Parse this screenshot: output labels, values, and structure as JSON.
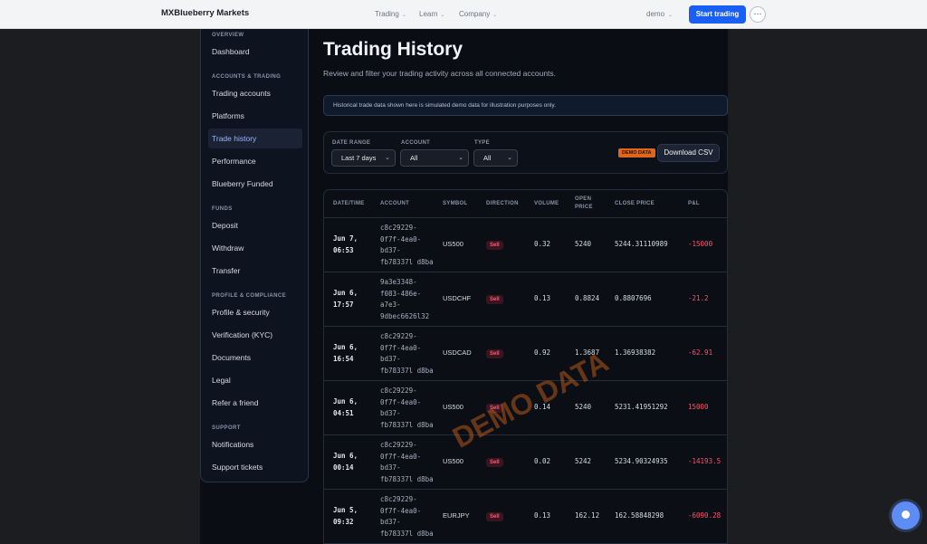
{
  "topbar": {
    "brand": "MXBlueberry Markets",
    "nav": [
      {
        "label": "Trading"
      },
      {
        "label": "Learn"
      },
      {
        "label": "Company"
      }
    ],
    "demo_select": "demo",
    "start_label": "Start trading",
    "more_label": "···"
  },
  "sidebar": {
    "sections": {
      "overview": "OVERVIEW",
      "accounts": "ACCOUNTS & TRADING",
      "funds": "FUNDS",
      "profile": "PROFILE & COMPLIANCE",
      "support": "SUPPORT"
    },
    "items": {
      "dashboard": "Dashboard",
      "trading_accounts": "Trading accounts",
      "platforms": "Platforms",
      "trade_history": "Trade history",
      "performance": "Performance",
      "funded": "Blueberry Funded",
      "deposit": "Deposit",
      "withdraw": "Withdraw",
      "transfer": "Transfer",
      "profile_security": "Profile & security",
      "verification": "Verification (KYC)",
      "documents": "Documents",
      "legal": "Legal",
      "refer": "Refer a friend",
      "notifications": "Notifications",
      "tickets": "Support tickets"
    }
  },
  "page": {
    "title": "Trading History",
    "subtitle": "Review and filter your trading activity across all connected accounts.",
    "notice": "Historical trade data shown here is simulated demo data for illustration purposes only."
  },
  "filters": {
    "date_label": "DATE RANGE",
    "date_value": "Last 7 days",
    "account_label": "ACCOUNT",
    "account_value": "All",
    "type_label": "TYPE",
    "type_value": "All",
    "demo_badge": "DEMO DATA",
    "download_label": "Download CSV"
  },
  "table": {
    "headers": {
      "datetime": "DATE/TIME",
      "account": "ACCOUNT",
      "symbol": "SYMBOL",
      "direction": "DIRECTION",
      "volume": "VOLUME",
      "open_price_1": "OPEN",
      "open_price_2": "PRICE",
      "close_price": "CLOSE PRICE",
      "pnl": "P&L"
    },
    "rows": [
      {
        "date": "Jun 7,",
        "time": "06:53",
        "acct": [
          "c8c29229-",
          "0f7f-4ea0-",
          "bd37-",
          "fb78337l d8ba"
        ],
        "symbol": "US500",
        "direction": "Sell",
        "volume": "0.32",
        "open": "5240",
        "close": "5244.31110989",
        "pnl": "-15000"
      },
      {
        "date": "Jun 6,",
        "time": "17:57",
        "acct": [
          "9a3e3348-",
          "f083-486e-",
          "a7e3-",
          "9dbec6626l32"
        ],
        "symbol": "USDCHF",
        "direction": "Sell",
        "volume": "0.13",
        "open": "0.8824",
        "close": "0.8807696",
        "pnl": "-21.2"
      },
      {
        "date": "Jun 6,",
        "time": "16:54",
        "acct": [
          "c8c29229-",
          "0f7f-4ea0-",
          "bd37-",
          "fb78337l d8ba"
        ],
        "symbol": "USDCAD",
        "direction": "Sell",
        "volume": "0.92",
        "open": "1.3687",
        "close": "1.36938382",
        "pnl": "-62.91"
      },
      {
        "date": "Jun 6,",
        "time": "04:51",
        "acct": [
          "c8c29229-",
          "0f7f-4ea0-",
          "bd37-",
          "fb78337l d8ba"
        ],
        "symbol": "US500",
        "direction": "Sell",
        "volume": "0.14",
        "open": "5240",
        "close": "5231.41951292",
        "pnl": "15000"
      },
      {
        "date": "Jun 6,",
        "time": "00:14",
        "acct": [
          "c8c29229-",
          "0f7f-4ea0-",
          "bd37-",
          "fb78337l d8ba"
        ],
        "symbol": "US500",
        "direction": "Sell",
        "volume": "0.02",
        "open": "5242",
        "close": "5234.90324935",
        "pnl": "-14193.5"
      },
      {
        "date": "Jun 5,",
        "time": "09:32",
        "acct": [
          "c8c29229-",
          "0f7f-4ea0-",
          "bd37-",
          "fb78337l d8ba"
        ],
        "symbol": "EURJPY",
        "direction": "Sell",
        "volume": "0.13",
        "open": "162.12",
        "close": "162.58848298",
        "pnl": "-6090.28"
      }
    ]
  },
  "watermark": "DEMO DATA",
  "colors": {
    "accent": "#1a5ff5",
    "loss": "#ff5468",
    "demo_badge": "#e0661c"
  }
}
